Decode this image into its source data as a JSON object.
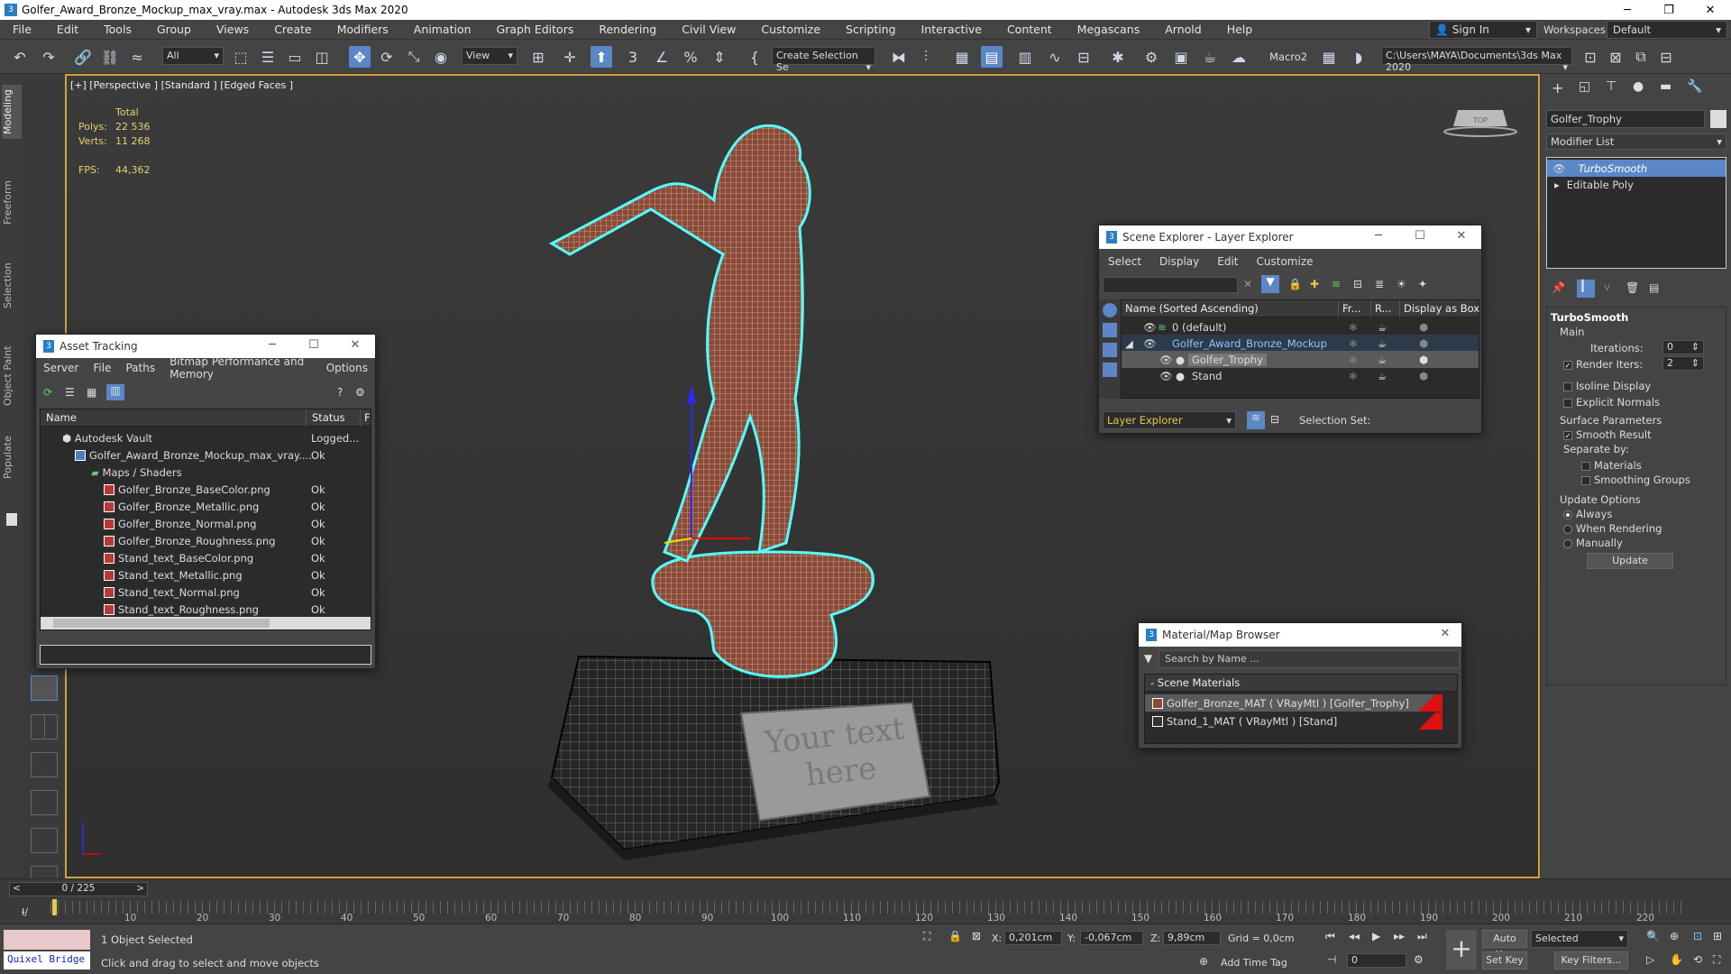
{
  "window": {
    "title": "Golfer_Award_Bronze_Mockup_max_vray.max - Autodesk 3ds Max 2020"
  },
  "menu": [
    "File",
    "Edit",
    "Tools",
    "Group",
    "Views",
    "Create",
    "Modifiers",
    "Animation",
    "Graph Editors",
    "Rendering",
    "Civil View",
    "Customize",
    "Scripting",
    "Interactive",
    "Content",
    "Megascans",
    "Arnold",
    "Help"
  ],
  "account": {
    "sign_in": "Sign In",
    "workspaces_label": "Workspaces:",
    "workspace": "Default"
  },
  "toolbar": {
    "selection_filter": "All",
    "ref_coord": "View",
    "named_selection": "Create Selection Se",
    "macro": "Macro2",
    "project_path": "C:\\Users\\MAYA\\Documents\\3ds Max 2020"
  },
  "left_tabs": [
    "Modeling",
    "Freeform",
    "Selection",
    "Object Paint",
    "Populate"
  ],
  "viewport": {
    "label": "[+] [Perspective ] [Standard ] [Edged Faces ]",
    "stats": {
      "total_label": "Total",
      "polys_label": "Polys:",
      "polys": "22 536",
      "verts_label": "Verts:",
      "verts": "11 268",
      "fps_label": "FPS:",
      "fps": "44,362"
    },
    "plate_text_1": "Your text",
    "plate_text_2": "here",
    "viewcube_label": "TOP"
  },
  "asset_tracking": {
    "title": "Asset Tracking",
    "menu": [
      "Server",
      "File",
      "Paths",
      "Bitmap Performance and Memory",
      "Options"
    ],
    "col_name": "Name",
    "col_status": "Status",
    "col_extra": "F",
    "rows": [
      {
        "name": "Autodesk Vault",
        "status": "Logged..."
      },
      {
        "name": "Golfer_Award_Bronze_Mockup_max_vray....",
        "status": "Ok"
      },
      {
        "name": "Maps / Shaders",
        "status": ""
      },
      {
        "name": "Golfer_Bronze_BaseColor.png",
        "status": "Ok"
      },
      {
        "name": "Golfer_Bronze_Metallic.png",
        "status": "Ok"
      },
      {
        "name": "Golfer_Bronze_Normal.png",
        "status": "Ok"
      },
      {
        "name": "Golfer_Bronze_Roughness.png",
        "status": "Ok"
      },
      {
        "name": "Stand_text_BaseColor.png",
        "status": "Ok"
      },
      {
        "name": "Stand_text_Metallic.png",
        "status": "Ok"
      },
      {
        "name": "Stand_text_Normal.png",
        "status": "Ok"
      },
      {
        "name": "Stand_text_Roughness.png",
        "status": "Ok"
      }
    ]
  },
  "scene_explorer": {
    "title": "Scene Explorer - Layer Explorer",
    "menu": [
      "Select",
      "Display",
      "Edit",
      "Customize"
    ],
    "col_name": "Name (Sorted Ascending)",
    "col_fr": "Fr...",
    "col_r": "R...",
    "col_box": "Display as Box",
    "rows": [
      {
        "name": "0 (default)"
      },
      {
        "name": "Golfer_Award_Bronze_Mockup"
      },
      {
        "name": "Golfer_Trophy"
      },
      {
        "name": "Stand"
      }
    ],
    "footer_dropdown": "Layer Explorer",
    "selection_set_label": "Selection Set:"
  },
  "material_browser": {
    "title": "Material/Map Browser",
    "search_placeholder": "Search by Name ...",
    "section": "- Scene Materials",
    "items": [
      "Golfer_Bronze_MAT ( VRayMtl ) [Golfer_Trophy]",
      "Stand_1_MAT ( VRayMtl ) [Stand]"
    ]
  },
  "command_panel": {
    "object_name": "Golfer_Trophy",
    "modifier_list": "Modifier List",
    "stack": [
      "TurboSmooth",
      "Editable Poly"
    ],
    "turbosmooth": {
      "rollout": "TurboSmooth",
      "main": "Main",
      "iterations_label": "Iterations:",
      "iterations": "0",
      "render_iters_label": "Render Iters:",
      "render_iters": "2",
      "isoline": "Isoline Display",
      "explicit_normals": "Explicit Normals",
      "surface_params": "Surface Parameters",
      "smooth_result": "Smooth Result",
      "separate_by": "Separate by:",
      "materials": "Materials",
      "smoothing_groups": "Smoothing Groups",
      "update_options": "Update Options",
      "always": "Always",
      "when_rendering": "When Rendering",
      "manually": "Manually",
      "update_btn": "Update"
    }
  },
  "timeline": {
    "frame": "0 / 225",
    "ticks": [
      "10",
      "20",
      "30",
      "40",
      "50",
      "60",
      "70",
      "80",
      "90",
      "100",
      "110",
      "120",
      "130",
      "140",
      "150",
      "160",
      "170",
      "180",
      "190",
      "200",
      "210",
      "220"
    ]
  },
  "status": {
    "quixel": "Quixel Bridge",
    "selected": "1 Object Selected",
    "hint": "Click and drag to select and move objects",
    "x_label": "X:",
    "x": "0,201cm",
    "y_label": "Y:",
    "y": "-0,067cm",
    "z_label": "Z:",
    "z": "9,89cm",
    "grid": "Grid = 0,0cm",
    "add_time_tag": "Add Time Tag",
    "auto_key": "Auto Key",
    "set_key": "Set Key",
    "selected_dd": "Selected",
    "key_filters": "Key Filters...",
    "frame_field": "0"
  }
}
